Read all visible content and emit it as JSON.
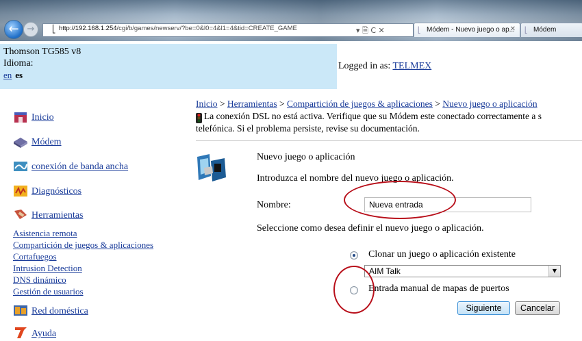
{
  "browser": {
    "url_host": "http://192.168.1.254",
    "url_path": "/cgi/b/games/newserv/?be=0&l0=4&l1=4&tid=CREATE_GAME",
    "address_tools": "▾ 🗎 C ✕",
    "tabs": [
      {
        "label": "Módem - Nuevo juego o ap...",
        "close": "✕"
      },
      {
        "label": "Módem"
      }
    ]
  },
  "header": {
    "device": "Thomson TG585 v8",
    "idioma_label": "Idioma:",
    "lang_en": "en",
    "lang_es": "es",
    "logged_prefix": "Logged in as:",
    "user": "TELMEX"
  },
  "sidebar": {
    "items": [
      {
        "label": "Inicio",
        "icon": "home-icon"
      },
      {
        "label": "Módem",
        "icon": "modem-icon"
      },
      {
        "label": "conexión de banda ancha",
        "icon": "broadband-icon"
      },
      {
        "label": "Diagnósticos",
        "icon": "diagnostics-icon"
      },
      {
        "label": "Herramientas",
        "icon": "tools-icon"
      }
    ],
    "subitems": [
      "Asistencia remota",
      "Compartición de juegos & aplicaciones",
      "Cortafuegos",
      "Intrusion Detection",
      "DNS dinámico",
      "Gestión de usuarios"
    ],
    "items2": [
      {
        "label": "Red doméstica",
        "icon": "home-network-icon"
      },
      {
        "label": "Ayuda",
        "icon": "help-icon"
      }
    ]
  },
  "breadcrumb": {
    "items": [
      "Inicio",
      "Herramientas",
      "Compartición de juegos & aplicaciones",
      "Nuevo juego o aplicación"
    ],
    "sep": ">"
  },
  "warning": {
    "line1": "La conexión DSL no está activa. Verifique que su Módem este conectado correctamente a s",
    "line2": "telefónica. Si el problema persiste, revise su documentación."
  },
  "form": {
    "title": "Nuevo juego o aplicación",
    "intro": "Introduzca el nombre del nuevo juego o aplicación.",
    "name_label": "Nombre:",
    "name_value": "Nueva entrada",
    "define_text": "Seleccione como desea definir el nuevo juego o aplicación.",
    "option_clone": "Clonar un juego o aplicación existente",
    "select_value": "AIM Talk",
    "option_manual": "Entrada manual de mapas de puertos",
    "next_button": "Siguiente",
    "cancel_button": "Cancelar"
  },
  "colors": {
    "link": "#1a3c9a",
    "header_bg": "#cbe8f8",
    "annotation": "#b80f1a"
  }
}
